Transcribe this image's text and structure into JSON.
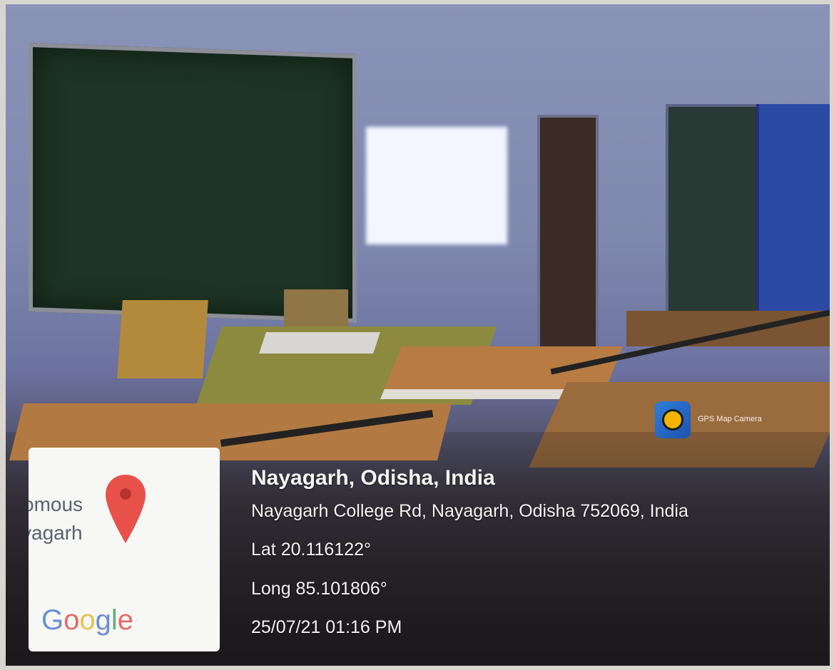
{
  "overlay": {
    "app_name": "GPS Map Camera",
    "map": {
      "label_line1": "omous",
      "label_line2": "yagarh",
      "logo_letters": [
        "G",
        "o",
        "o",
        "g",
        "l",
        "e"
      ]
    },
    "location_title": "Nayagarh, Odisha, India",
    "address": "Nayagarh College Rd, Nayagarh, Odisha 752069, India",
    "latitude": "Lat 20.116122°",
    "longitude": "Long 85.101806°",
    "timestamp": "25/07/21 01:16 PM"
  },
  "icons": {
    "app_icon": "gps-map-camera-icon",
    "map_pin": "map-pin-icon"
  },
  "colors": {
    "pin_red": "#e8514a",
    "app_icon_blue": "#2f7fd8"
  }
}
